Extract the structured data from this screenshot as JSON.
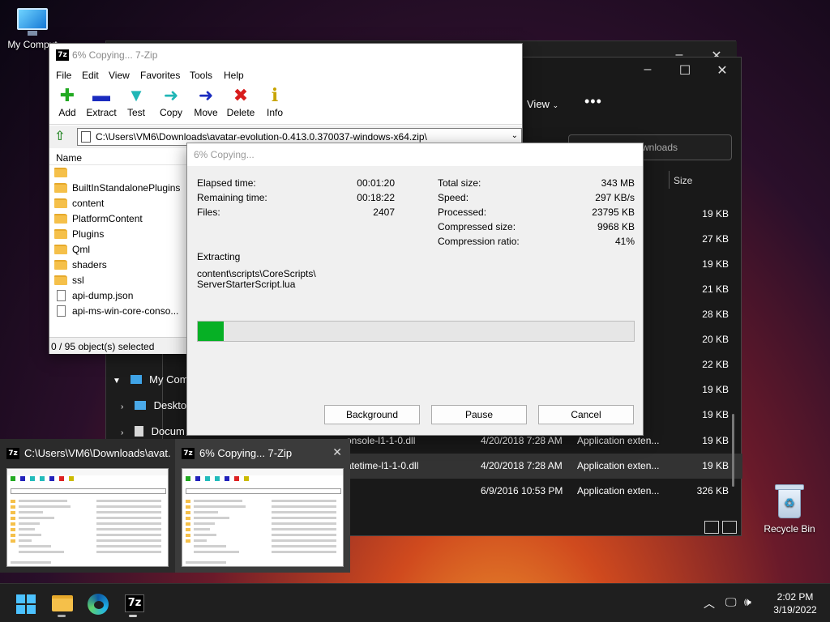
{
  "desktop": {
    "computer_label": "My Comput",
    "recycle_label": "Recycle Bin"
  },
  "explorer": {
    "view_label": "View",
    "more_label": "•••",
    "search_placeholder": "wnloads",
    "size_header": "Size",
    "sizes": [
      "19 KB",
      "27 KB",
      "19 KB",
      "21 KB",
      "28 KB",
      "20 KB",
      "22 KB",
      "19 KB",
      "19 KB"
    ],
    "nav": [
      {
        "label": "My Comp"
      },
      {
        "label": "Desktop"
      },
      {
        "label": "Docum"
      }
    ],
    "rows": [
      {
        "name": "onsole-l1-1-0.dll",
        "date": "4/20/2018 7:28 AM",
        "type": "Application exten...",
        "size": "19 KB"
      },
      {
        "name": "atetime-l1-1-0.dll",
        "date": "4/20/2018 7:28 AM",
        "type": "Application exten...",
        "size": "19 KB"
      },
      {
        "name": "",
        "date": "6/9/2016 10:53 PM",
        "type": "Application exten...",
        "size": "326 KB"
      }
    ]
  },
  "zip": {
    "title": "6% Copying... 7-Zip",
    "app_icon": "7z",
    "menu": [
      "File",
      "Edit",
      "View",
      "Favorites",
      "Tools",
      "Help"
    ],
    "toolbar": [
      {
        "label": "Add",
        "glyph": "✚",
        "color": "#22aa22"
      },
      {
        "label": "Extract",
        "glyph": "▬",
        "color": "#1a2bbf"
      },
      {
        "label": "Test",
        "glyph": "▼",
        "color": "#20b6b6"
      },
      {
        "label": "Copy",
        "glyph": "➜",
        "color": "#20b6b6"
      },
      {
        "label": "Move",
        "glyph": "➜",
        "color": "#1a2bbf"
      },
      {
        "label": "Delete",
        "glyph": "✖",
        "color": "#d81c1c"
      },
      {
        "label": "Info",
        "glyph": "i",
        "color": "#c8a400"
      }
    ],
    "address": "C:\\Users\\VM6\\Downloads\\avatar-evolution-0.413.0.370037-windows-x64.zip\\",
    "column_name": "Name",
    "items": [
      {
        "name": "",
        "kind": "folder"
      },
      {
        "name": "BuiltInStandalonePlugins",
        "kind": "folder"
      },
      {
        "name": "content",
        "kind": "folder"
      },
      {
        "name": "PlatformContent",
        "kind": "folder"
      },
      {
        "name": "Plugins",
        "kind": "folder"
      },
      {
        "name": "Qml",
        "kind": "folder"
      },
      {
        "name": "shaders",
        "kind": "folder"
      },
      {
        "name": "ssl",
        "kind": "folder"
      },
      {
        "name": "api-dump.json",
        "kind": "file"
      },
      {
        "name": "api-ms-win-core-conso...",
        "kind": "file"
      }
    ],
    "status": "0 / 95 object(s) selected"
  },
  "progress": {
    "title": "6% Copying...",
    "elapsed_label": "Elapsed time:",
    "elapsed": "00:01:20",
    "remaining_label": "Remaining time:",
    "remaining": "00:18:22",
    "files_label": "Files:",
    "files": "2407",
    "total_label": "Total size:",
    "total": "343 MB",
    "speed_label": "Speed:",
    "speed": "297 KB/s",
    "processed_label": "Processed:",
    "processed": "23795 KB",
    "compressed_label": "Compressed size:",
    "compressed": "9968 KB",
    "ratio_label": "Compression ratio:",
    "ratio": "41%",
    "action": "Extracting",
    "path_line1": "content\\scripts\\CoreScripts\\",
    "path_line2": "ServerStarterScript.lua",
    "percent": 6,
    "btn_background": "Background",
    "btn_pause": "Pause",
    "btn_cancel": "Cancel"
  },
  "previews": [
    {
      "title": "C:\\Users\\VM6\\Downloads\\avat..."
    },
    {
      "title": "6% Copying... 7-Zip",
      "close": "✕"
    }
  ],
  "taskbar": {
    "time": "2:02 PM",
    "date": "3/19/2022",
    "sevenzip_label": "7z"
  }
}
